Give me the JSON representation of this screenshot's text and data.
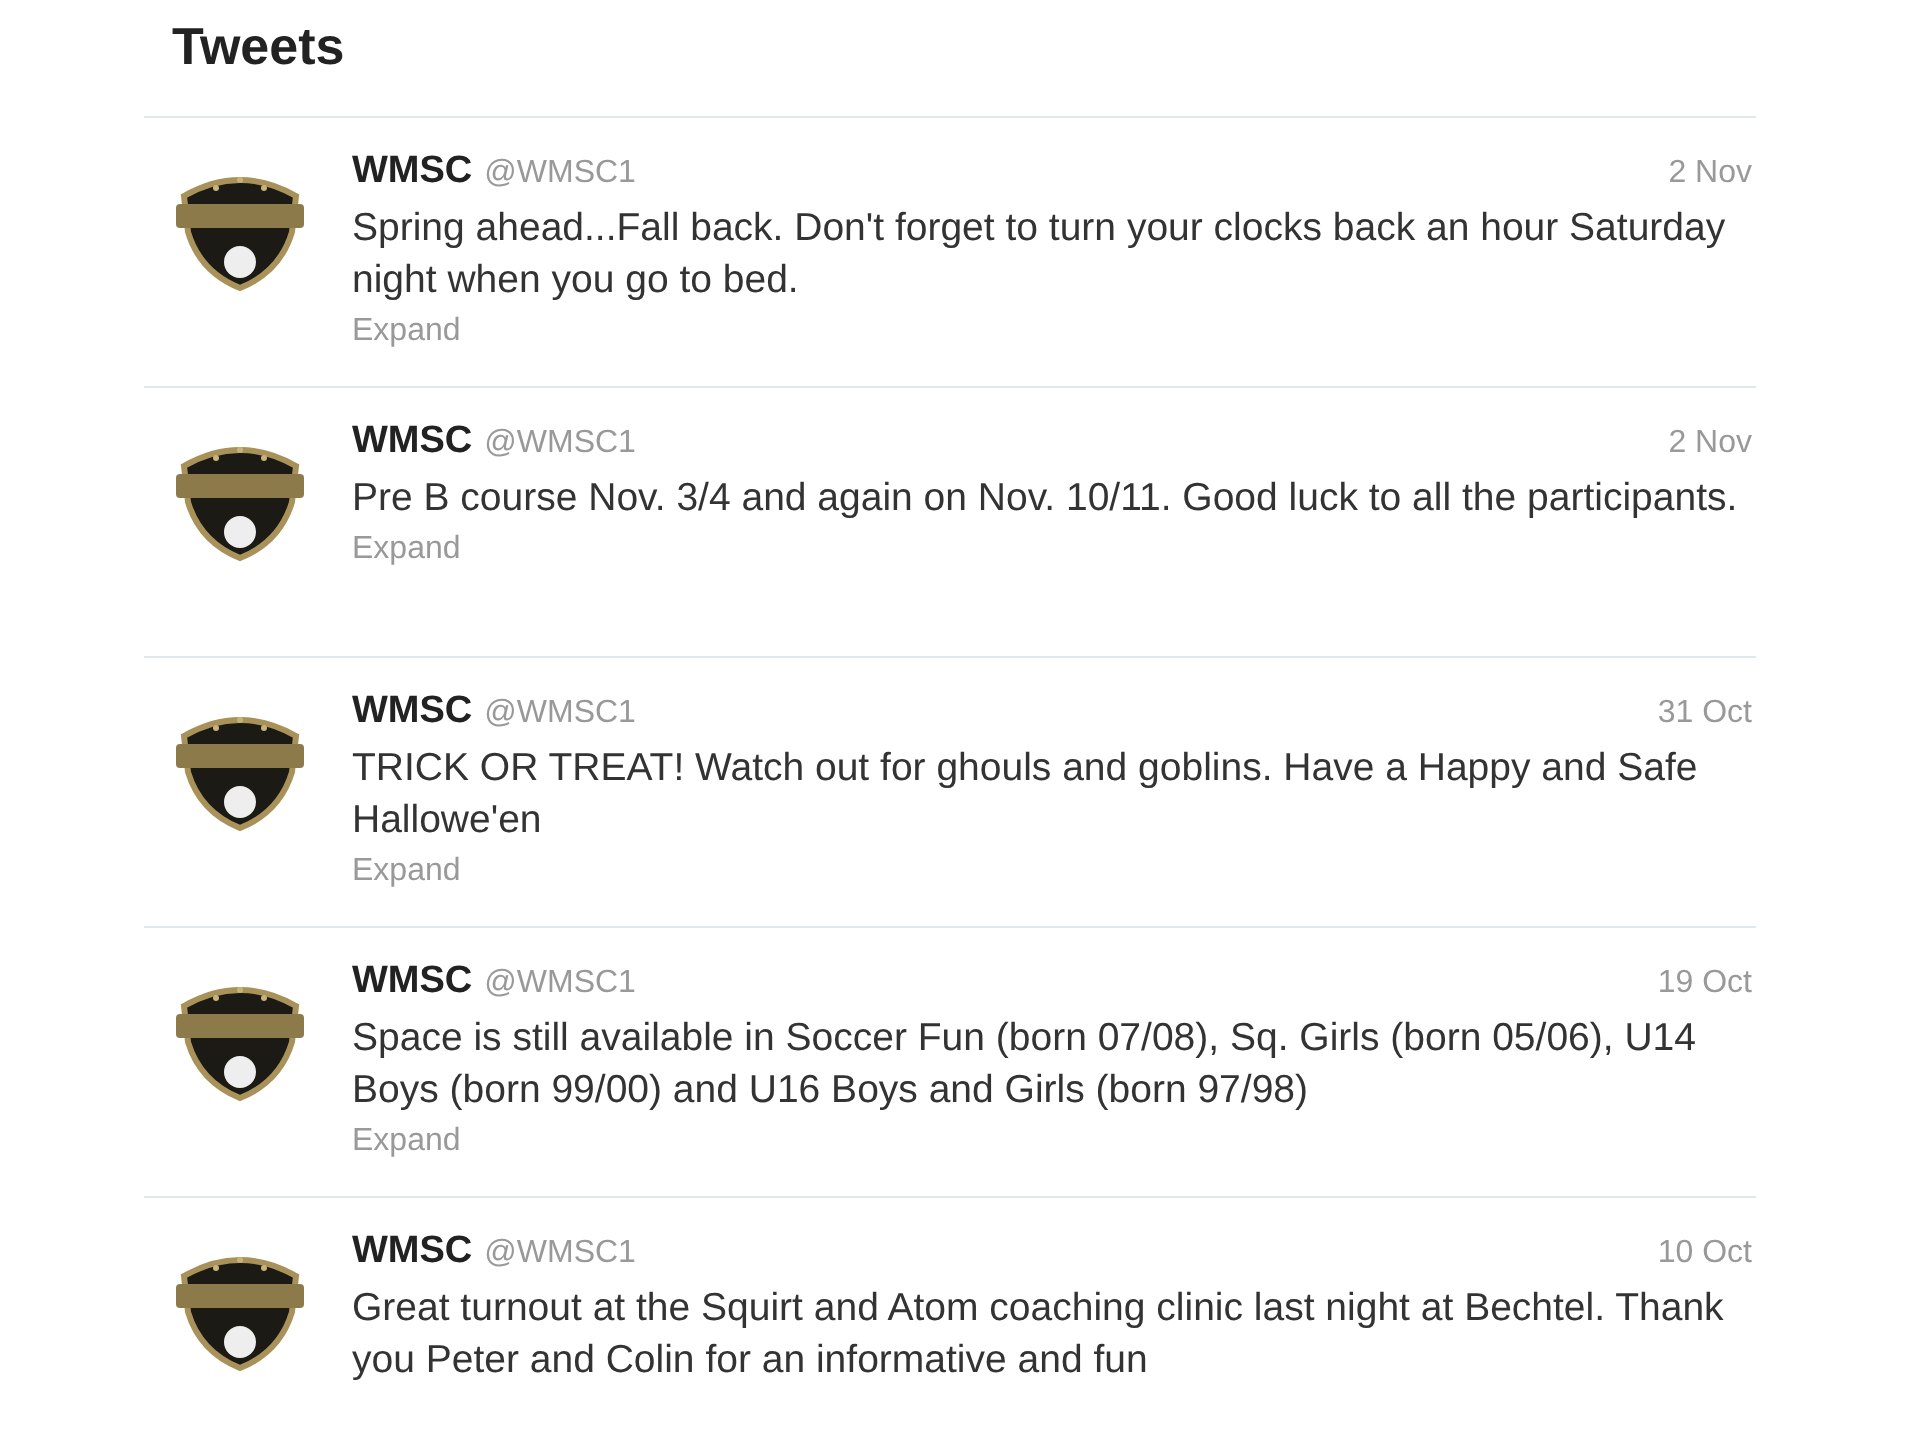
{
  "heading": "Tweets",
  "tweets": [
    {
      "name": "WMSC",
      "handle": "@WMSC1",
      "date": "2 Nov",
      "text": "Spring ahead...Fall back. Don't forget to turn your clocks back an hour Saturday night when you go to bed.",
      "expand": "Expand"
    },
    {
      "name": "WMSC",
      "handle": "@WMSC1",
      "date": "2 Nov",
      "text": "Pre B course Nov. 3/4 and again on Nov. 10/11. Good luck to all the participants.",
      "expand": "Expand"
    },
    {
      "name": "WMSC",
      "handle": "@WMSC1",
      "date": "31 Oct",
      "text": "TRICK OR TREAT! Watch out for ghouls and goblins. Have a Happy and Safe Hallowe'en",
      "expand": "Expand"
    },
    {
      "name": "WMSC",
      "handle": "@WMSC1",
      "date": "19 Oct",
      "text": "Space is still available in Soccer Fun (born 07/08), Sq. Girls (born 05/06), U14 Boys (born 99/00) and U16 Boys and Girls (born 97/98)",
      "expand": "Expand"
    },
    {
      "name": "WMSC",
      "handle": "@WMSC1",
      "date": "10 Oct",
      "text": "Great turnout at the Squirt and Atom coaching clinic last night at Bechtel. Thank you Peter and Colin for an informative and fun"
    }
  ]
}
